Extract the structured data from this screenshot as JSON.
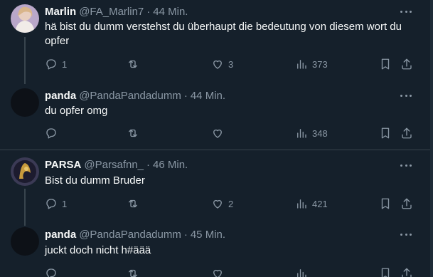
{
  "tweets": [
    {
      "name": "Marlin",
      "handle": "@FA_Marlin7",
      "sep": "·",
      "time": "44 Min.",
      "text": "hä bist du dumm verstehst du überhaupt die bedeutung von diesem wort du opfer",
      "replies": "1",
      "retweets": "",
      "likes": "3",
      "views": "373"
    },
    {
      "name": "panda",
      "handle": "@PandaPandadumm",
      "sep": "·",
      "time": "44 Min.",
      "text": "du opfer omg",
      "replies": "",
      "retweets": "",
      "likes": "",
      "views": "348"
    },
    {
      "name": "PARSA",
      "handle": "@Parsafnn_",
      "sep": "·",
      "time": "46 Min.",
      "text": "Bist du dumm Bruder",
      "replies": "1",
      "retweets": "",
      "likes": "2",
      "views": "421"
    },
    {
      "name": "panda",
      "handle": "@PandaPandadumm",
      "sep": "·",
      "time": "45 Min.",
      "text": "juckt doch nicht h#äää",
      "replies": "",
      "retweets": "",
      "likes": "",
      "views": ""
    }
  ],
  "colors": {
    "background": "#15202b",
    "text": "#f7f9f9",
    "muted": "#8b98a5",
    "border": "#38444d"
  },
  "icons": [
    "reply-icon",
    "retweet-icon",
    "like-icon",
    "views-icon",
    "bookmark-icon",
    "share-icon",
    "more-icon"
  ]
}
